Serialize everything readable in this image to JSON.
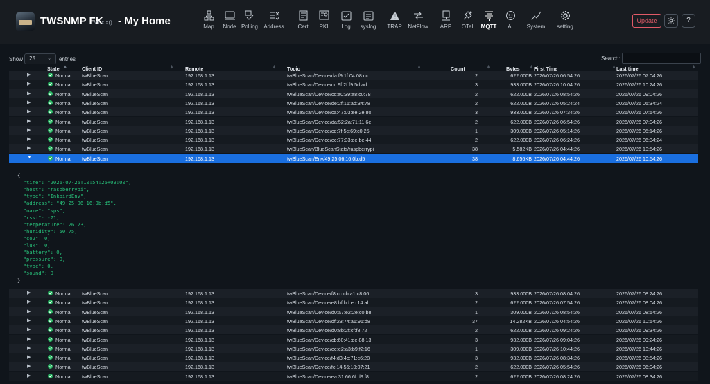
{
  "app": {
    "name": "TWSNMP FK",
    "version": "vx.x.x()",
    "title": "- My Home"
  },
  "nav": [
    {
      "label": "Map",
      "icon": "map-icon"
    },
    {
      "label": "Node",
      "icon": "node-icon"
    },
    {
      "label": "Polling",
      "icon": "polling-icon"
    },
    {
      "label": "Address",
      "icon": "address-icon"
    },
    {
      "label": "Cert",
      "icon": "cert-icon"
    },
    {
      "label": "PKI",
      "icon": "pki-icon"
    },
    {
      "label": "Log",
      "icon": "log-icon"
    },
    {
      "label": "syslog",
      "icon": "syslog-icon"
    },
    {
      "label": "TRAP",
      "icon": "trap-icon"
    },
    {
      "label": "NetFlow",
      "icon": "netflow-icon"
    },
    {
      "label": "ARP",
      "icon": "arp-icon"
    },
    {
      "label": "OTel",
      "icon": "otel-icon"
    },
    {
      "label": "MQTT",
      "icon": "mqtt-icon",
      "active": true
    },
    {
      "label": "AI",
      "icon": "ai-icon"
    },
    {
      "label": "System",
      "icon": "system-icon"
    },
    {
      "label": "setting",
      "icon": "setting-icon"
    }
  ],
  "toolbar": {
    "update_label": "Update",
    "theme_icon": "sun-icon",
    "help_label": "?"
  },
  "table_controls": {
    "show_label": "Show",
    "entries_value": "25",
    "entries_label": "entries",
    "search_label": "Search:",
    "search_value": ""
  },
  "columns": [
    "State",
    "Client ID",
    "Remote",
    "Topic",
    "Count",
    "Bytes",
    "First Time",
    "Last time"
  ],
  "rows": [
    {
      "state": "Normal",
      "client": "twBlueScan",
      "remote": "192.168.1.13",
      "topic": "twBlueScan/Device/da:f9:1f:04:08:cc",
      "count": "2",
      "bytes": "622.000B",
      "first": "2026/07/26 06:54:26",
      "last": "2026/07/26 07:04:26"
    },
    {
      "state": "Normal",
      "client": "twBlueScan",
      "remote": "192.168.1.13",
      "topic": "twBlueScan/Device/cc:9f:2f:f9:5d:ad",
      "count": "3",
      "bytes": "933.000B",
      "first": "2026/07/26 10:04:26",
      "last": "2026/07/26 10:24:26"
    },
    {
      "state": "Normal",
      "client": "twBlueScan",
      "remote": "192.168.1.13",
      "topic": "twBlueScan/Device/cc:a0:39:a8:c0:78",
      "count": "2",
      "bytes": "622.000B",
      "first": "2026/07/26 08:54:26",
      "last": "2026/07/26 09:04:26"
    },
    {
      "state": "Normal",
      "client": "twBlueScan",
      "remote": "192.168.1.13",
      "topic": "twBlueScan/Device/de:2f:16:ad:34:78",
      "count": "2",
      "bytes": "622.000B",
      "first": "2026/07/26 05:24:24",
      "last": "2026/07/26 05:34:24"
    },
    {
      "state": "Normal",
      "client": "twBlueScan",
      "remote": "192.168.1.13",
      "topic": "twBlueScan/Device/ca:47:03:ee:2e:80",
      "count": "3",
      "bytes": "933.000B",
      "first": "2026/07/26 07:34:26",
      "last": "2026/07/26 07:54:26"
    },
    {
      "state": "Normal",
      "client": "twBlueScan",
      "remote": "192.168.1.13",
      "topic": "twBlueScan/Device/da:52:2a:71:11:6e",
      "count": "2",
      "bytes": "622.000B",
      "first": "2026/07/26 06:54:26",
      "last": "2026/07/26 07:04:26"
    },
    {
      "state": "Normal",
      "client": "twBlueScan",
      "remote": "192.168.1.13",
      "topic": "twBlueScan/Device/cd:7f:5c:69:c0:25",
      "count": "1",
      "bytes": "309.000B",
      "first": "2026/07/26 05:14:26",
      "last": "2026/07/26 05:14:26"
    },
    {
      "state": "Normal",
      "client": "twBlueScan",
      "remote": "192.168.1.13",
      "topic": "twBlueScan/Device/ec:77:33:ee:be:44",
      "count": "2",
      "bytes": "622.000B",
      "first": "2026/07/26 06:24:26",
      "last": "2026/07/26 06:34:24"
    },
    {
      "state": "Normal",
      "client": "twBlueScan",
      "remote": "192.168.1.13",
      "topic": "twBlueScan/BlueScanStats/raspberrypi",
      "count": "38",
      "bytes": "5.582KB",
      "first": "2026/07/26 04:44:26",
      "last": "2026/07/26 10:54:26"
    },
    {
      "state": "Normal",
      "client": "twBlueScan",
      "remote": "192.168.1.13",
      "topic": "twBlueScan/Env/49:25:06:16:0b:d5",
      "count": "38",
      "bytes": "8.656KB",
      "first": "2026/07/26 04:44:26",
      "last": "2026/07/26 10:54:26",
      "selected": true
    },
    {
      "state": "Normal",
      "client": "twBlueScan",
      "remote": "192.168.1.13",
      "topic": "twBlueScan/Device/f8:cc:cb:a1:c8:06",
      "count": "3",
      "bytes": "933.000B",
      "first": "2026/07/26 08:04:26",
      "last": "2026/07/26 08:24:26"
    },
    {
      "state": "Normal",
      "client": "twBlueScan",
      "remote": "192.168.1.13",
      "topic": "twBlueScan/Device/e8:bf:bd:ec:14:af",
      "count": "2",
      "bytes": "622.000B",
      "first": "2026/07/26 07:54:26",
      "last": "2026/07/26 08:04:26"
    },
    {
      "state": "Normal",
      "client": "twBlueScan",
      "remote": "192.168.1.13",
      "topic": "twBlueScan/Device/d0:a7:e2:2e:c0:b8",
      "count": "1",
      "bytes": "309.000B",
      "first": "2026/07/26 08:54:26",
      "last": "2026/07/26 08:54:26"
    },
    {
      "state": "Normal",
      "client": "twBlueScan",
      "remote": "192.168.1.13",
      "topic": "twBlueScan/Device/df:23:74:a1:96:d8",
      "count": "37",
      "bytes": "14.282KB",
      "first": "2026/07/26 04:54:26",
      "last": "2026/07/26 10:54:26"
    },
    {
      "state": "Normal",
      "client": "twBlueScan",
      "remote": "192.168.1.13",
      "topic": "twBlueScan/Device/d0:8b:2f:cf:f8:72",
      "count": "2",
      "bytes": "622.000B",
      "first": "2026/07/26 09:24:26",
      "last": "2026/07/26 09:34:26"
    },
    {
      "state": "Normal",
      "client": "twBlueScan",
      "remote": "192.168.1.13",
      "topic": "twBlueScan/Device/cb:60:41:de:88:13",
      "count": "3",
      "bytes": "932.000B",
      "first": "2026/07/26 09:04:26",
      "last": "2026/07/26 09:24:26"
    },
    {
      "state": "Normal",
      "client": "twBlueScan",
      "remote": "192.168.1.13",
      "topic": "twBlueScan/Device/ee:e2:a3:b9:f2:16",
      "count": "1",
      "bytes": "309.000B",
      "first": "2026/07/26 10:44:26",
      "last": "2026/07/26 10:44:26"
    },
    {
      "state": "Normal",
      "client": "twBlueScan",
      "remote": "192.168.1.13",
      "topic": "twBlueScan/Device/f4:d3:4c:71:c6:28",
      "count": "3",
      "bytes": "932.000B",
      "first": "2026/07/26 08:34:26",
      "last": "2026/07/26 08:54:26"
    },
    {
      "state": "Normal",
      "client": "twBlueScan",
      "remote": "192.168.1.13",
      "topic": "twBlueScan/Device/fc:14:55:10:07:21",
      "count": "2",
      "bytes": "622.000B",
      "first": "2026/07/26 05:54:26",
      "last": "2026/07/26 06:04:26"
    },
    {
      "state": "Normal",
      "client": "twBlueScan",
      "remote": "192.168.1.13",
      "topic": "twBlueScan/Device/ea:31:66:6f:d9:f8",
      "count": "2",
      "bytes": "622.000B",
      "first": "2026/07/26 08:24:26",
      "last": "2026/07/26 08:34:26"
    }
  ],
  "detail_lines": [
    "{",
    "  \"time\": \"2026-07-26T10:54:26+09:00\",",
    "  \"host\": \"raspberrypi\",",
    "  \"type\": \"InkbirdEnv\",",
    "  \"address\": \"49:25:06:16:0b:d5\",",
    "  \"name\": \"sps\",",
    "  \"rssi\": -71,",
    "  \"temperature\": 26.23,",
    "  \"humidity\": 50.75,",
    "  \"co2\": 0,",
    "  \"lux\": 0,",
    "  \"battery\": 0,",
    "  \"pressure\": 0,",
    "  \"tvoc\": 0,",
    "  \"sound\": 0",
    "}"
  ],
  "colors": {
    "accent": "#1a6fe0",
    "status_ok": "#27b561",
    "update": "#e05a67",
    "json": "#28c07a"
  }
}
